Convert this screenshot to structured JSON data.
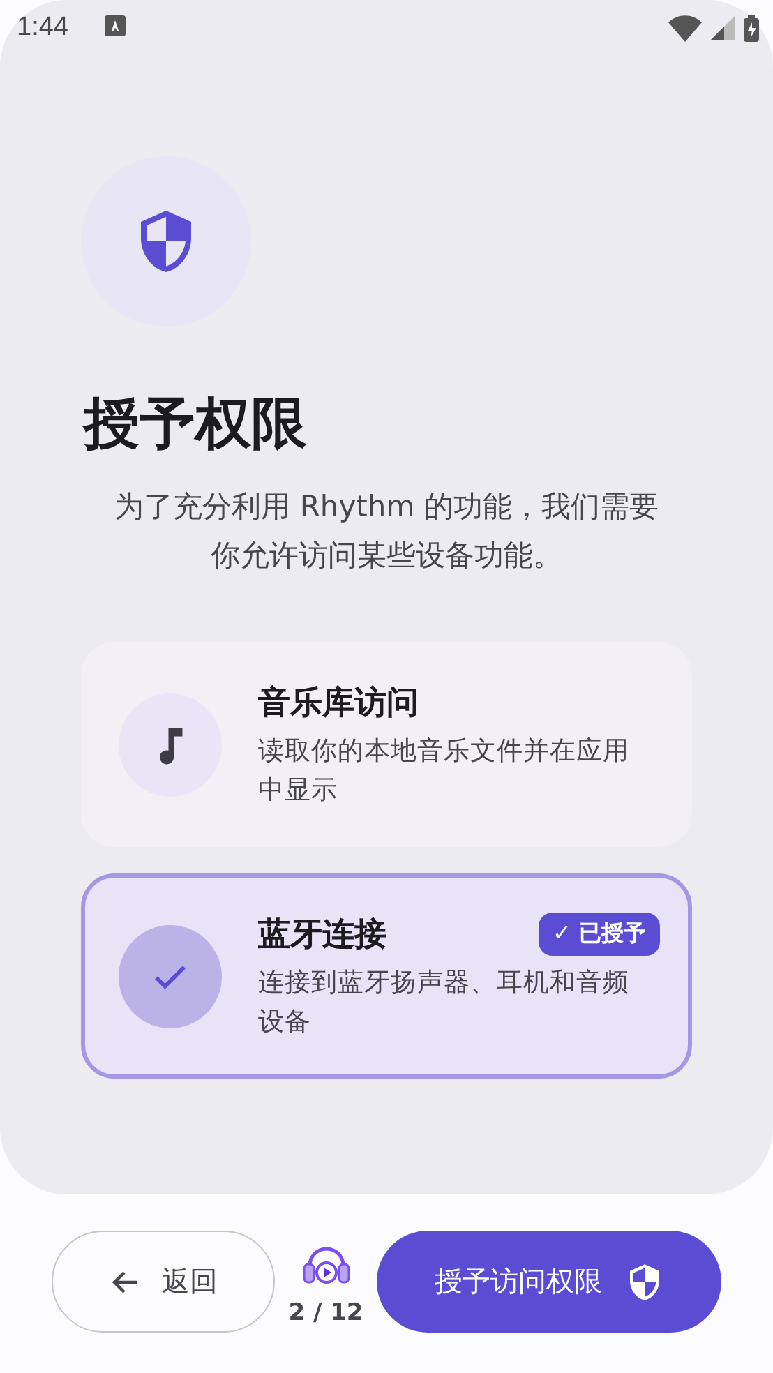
{
  "status_bar": {
    "time": "1:44"
  },
  "header": {
    "title": "授予权限",
    "description": "为了充分利用 Rhythm 的功能，我们需要你允许访问某些设备功能。"
  },
  "permissions": [
    {
      "title": "音乐库访问",
      "description": "读取你的本地音乐文件并在应用中显示",
      "kind": "music",
      "granted": false
    },
    {
      "title": "蓝牙连接",
      "description": "连接到蓝牙扬声器、耳机和音频设备",
      "granted": true,
      "badge": "✓ 已授予"
    }
  ],
  "footer": {
    "back": "返回",
    "progress": "2 / 12",
    "primary": "授予访问权限"
  }
}
